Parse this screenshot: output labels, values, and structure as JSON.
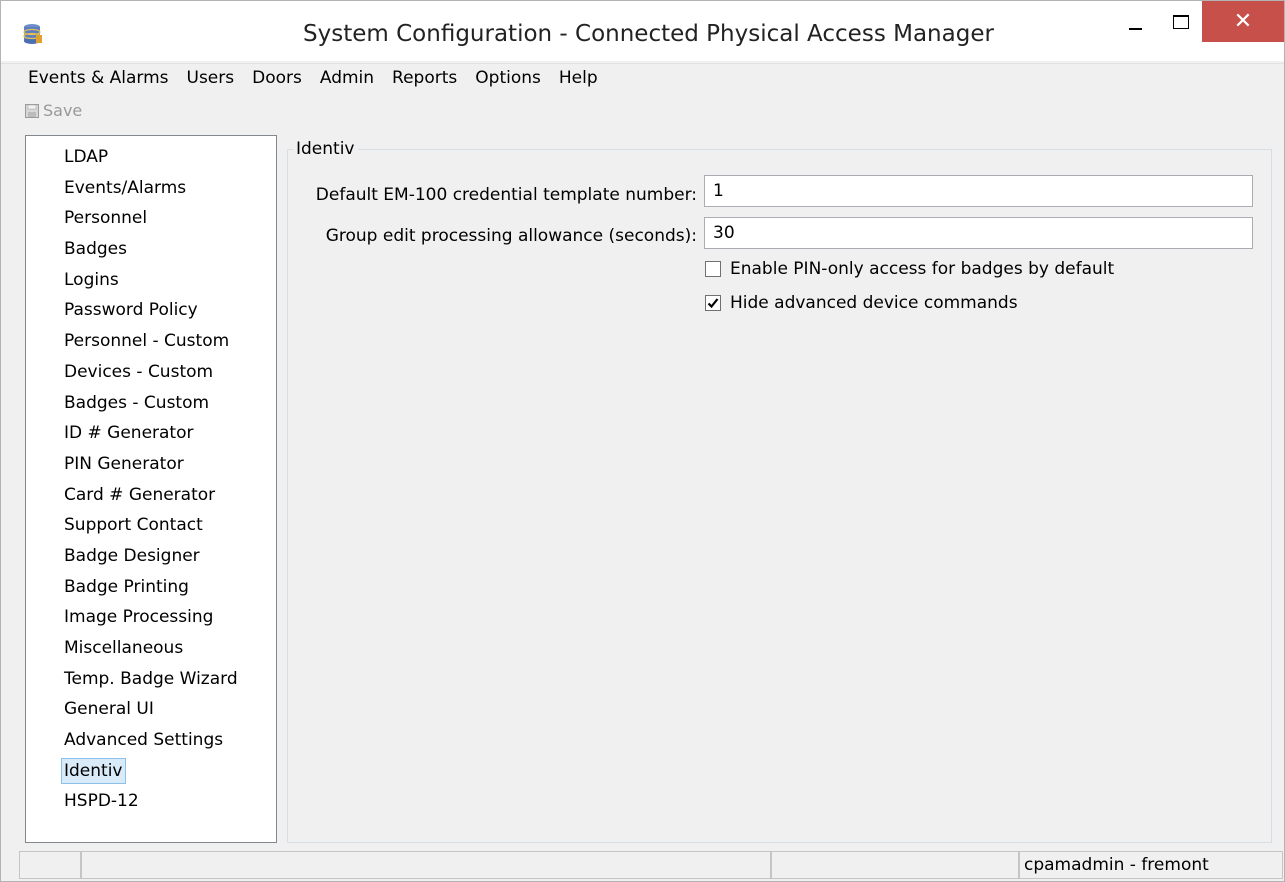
{
  "window": {
    "title": "System Configuration - Connected Physical Access Manager",
    "close_glyph": "✕"
  },
  "menu": {
    "items": [
      "Events & Alarms",
      "Users",
      "Doors",
      "Admin",
      "Reports",
      "Options",
      "Help"
    ]
  },
  "toolbar": {
    "save_label": "Save",
    "save_icon": "floppy-disk-icon"
  },
  "sidebar": {
    "items": [
      "LDAP",
      "Events/Alarms",
      "Personnel",
      "Badges",
      "Logins",
      "Password Policy",
      "Personnel - Custom",
      "Devices - Custom",
      "Badges - Custom",
      "ID # Generator",
      "PIN Generator",
      "Card # Generator",
      "Support Contact",
      "Badge Designer",
      "Badge Printing",
      "Image Processing",
      "Miscellaneous",
      "Temp. Badge Wizard",
      "General UI",
      "Advanced Settings",
      "Identiv",
      "HSPD-12"
    ],
    "selected_index": 20
  },
  "panel": {
    "group_title": "Identiv",
    "template_label": "Default EM-100 credential template number:",
    "template_value": "1",
    "allowance_label": "Group edit processing allowance (seconds):",
    "allowance_value": "30",
    "pin_only_label": "Enable PIN-only access for badges by default",
    "pin_only_checked": false,
    "hide_advanced_label": "Hide advanced device commands",
    "hide_advanced_checked": true
  },
  "status": {
    "panel1": "",
    "panel2": "",
    "panel3": "",
    "user_info": "cpamadmin - fremont"
  },
  "colors": {
    "close_button": "#c7504a",
    "selection_bg": "#d9ebf9",
    "selection_border": "#8ec1ea",
    "window_bg": "#f0f0f0"
  }
}
